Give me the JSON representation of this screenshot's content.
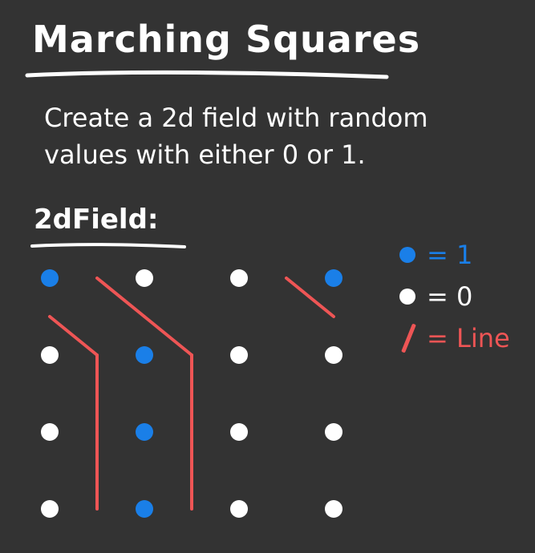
{
  "title": "Marching Squares",
  "description": "Create a 2d field with random values with either 0 or 1.",
  "field_heading": "2dField:",
  "colors": {
    "background": "#333333",
    "one": "#1a7fe8",
    "zero": "#ffffff",
    "line": "#ee5555",
    "text": "#ffffff"
  },
  "field": {
    "rows": 4,
    "cols": 4,
    "values": [
      [
        1,
        0,
        0,
        1
      ],
      [
        0,
        1,
        0,
        0
      ],
      [
        0,
        1,
        0,
        0
      ],
      [
        0,
        1,
        0,
        0
      ]
    ]
  },
  "legend": {
    "one": {
      "symbol": "dot",
      "label": "= 1"
    },
    "zero": {
      "symbol": "dot",
      "label": "= 0"
    },
    "line": {
      "symbol": "slash",
      "label": "= Line"
    }
  }
}
